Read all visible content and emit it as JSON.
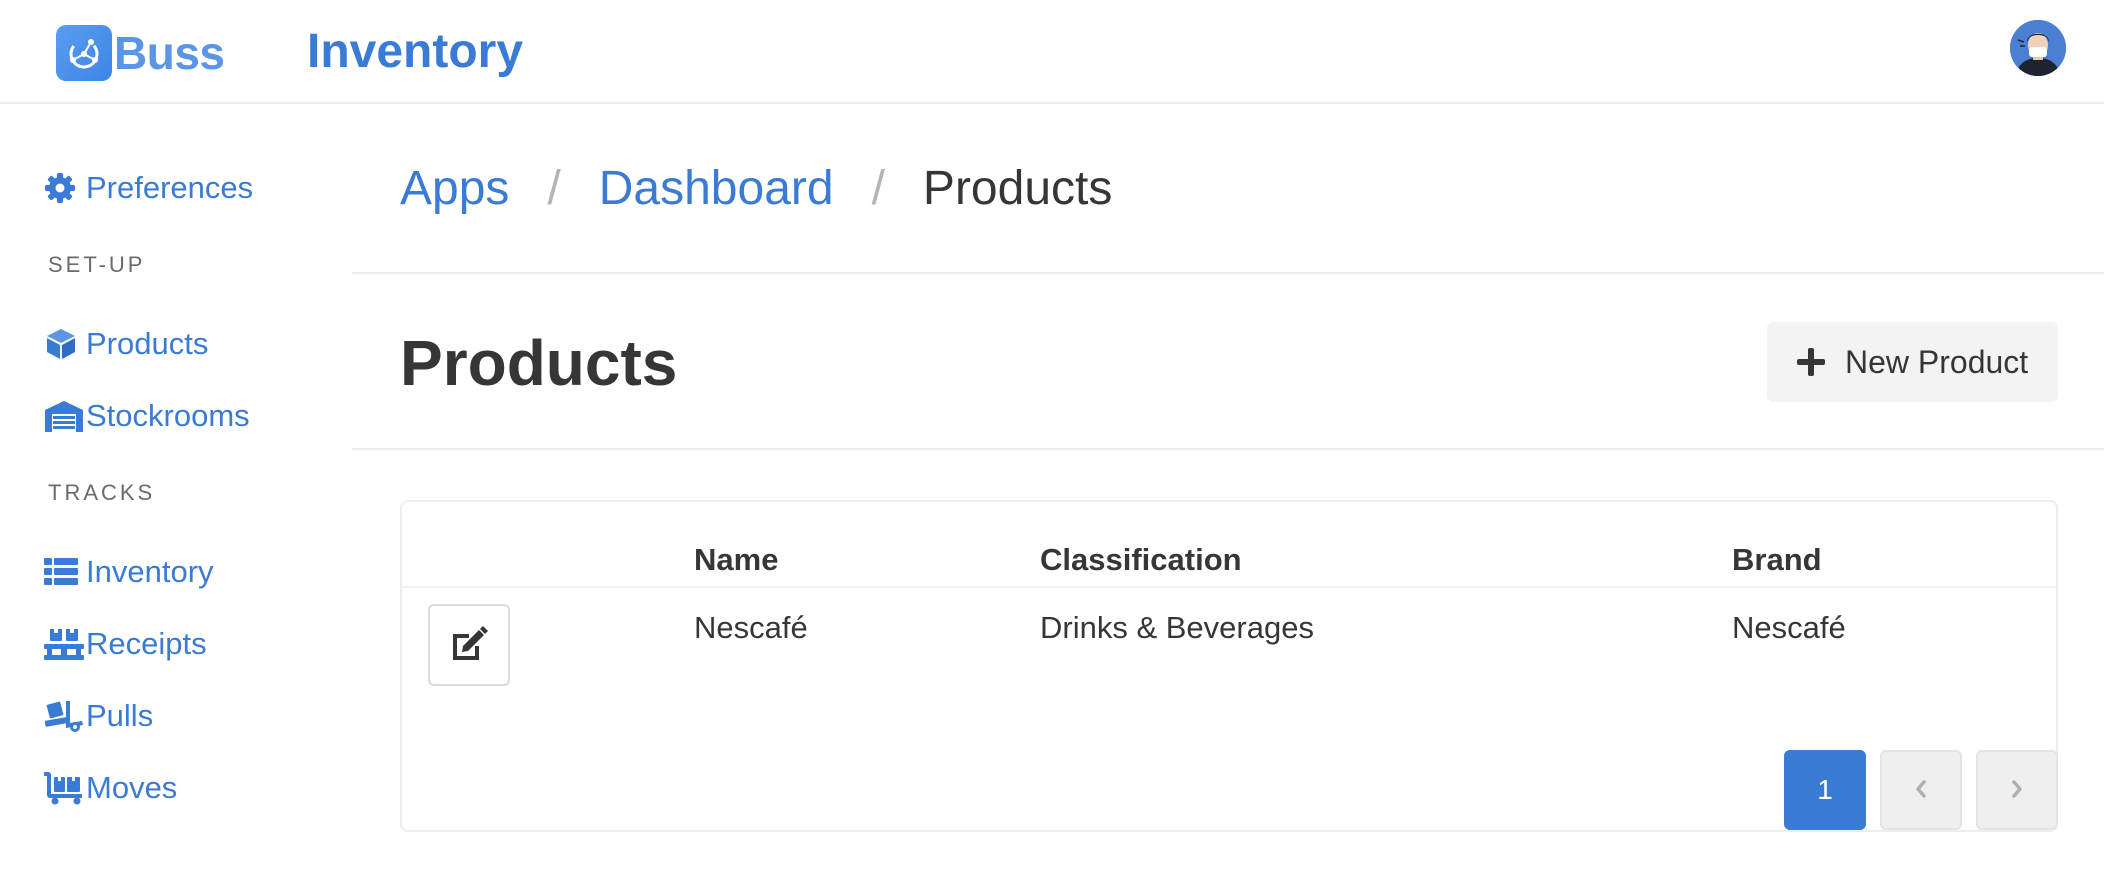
{
  "header": {
    "logo_text": "Buss",
    "app_title": "Inventory"
  },
  "sidebar": {
    "preferences": "Preferences",
    "setup_label": "SET-UP",
    "products": "Products",
    "stockrooms": "Stockrooms",
    "tracks_label": "TRACKS",
    "inventory": "Inventory",
    "receipts": "Receipts",
    "pulls": "Pulls",
    "moves": "Moves"
  },
  "breadcrumb": {
    "items": [
      "Apps",
      "Dashboard",
      "Products"
    ],
    "separator": "/"
  },
  "page": {
    "title": "Products",
    "new_button": "New Product"
  },
  "table": {
    "columns": [
      "Name",
      "Classification",
      "Brand"
    ],
    "rows": [
      {
        "name": "Nescafé",
        "classification": "Drinks & Beverages",
        "brand": "Nescafé"
      }
    ]
  },
  "pagination": {
    "current_page": "1"
  },
  "colors": {
    "accent": "#3a7bd5",
    "text": "#363636",
    "muted": "#6b6b6b"
  },
  "icons": {
    "preferences": "gear-icon",
    "products": "cube-icon",
    "stockrooms": "warehouse-icon",
    "inventory": "list-icon",
    "receipts": "pallet-icon",
    "pulls": "dolly-icon",
    "moves": "cart-flatbed-icon",
    "new_product": "plus-icon",
    "edit": "edit-icon"
  }
}
